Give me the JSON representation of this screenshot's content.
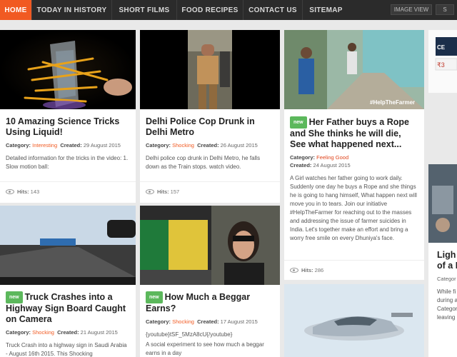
{
  "nav": {
    "items": [
      "HOME",
      "TODAY IN HISTORY",
      "SHORT FILMS",
      "FOOD RECIPES",
      "CONTACT US",
      "SITEMAP"
    ],
    "image_view": "IMAGE VIEW",
    "s_button": "S"
  },
  "labels": {
    "category": "Category:",
    "created": "Created:",
    "hits": "Hits:",
    "new": "new"
  },
  "cards": [
    {
      "title": "10 Amazing Science Tricks Using Liquid!",
      "category": "Interesting",
      "created": "29 August 2015",
      "desc": "Detailed information for the tricks in the video: 1. Slow motion ball:",
      "hits": "143"
    },
    {
      "title": "Delhi Police Cop Drunk in Delhi Metro",
      "category": "Shocking",
      "created": "26 August 2015",
      "desc": "Delhi police cop drunk in Delhi Metro, he falls down as the Train stops. watch video.",
      "hits": "157"
    },
    {
      "title": "Her Father buys a Rope and She thinks he will die, See what happened next...",
      "category": "Feeling Good",
      "created": "24 August 2015",
      "desc": "A Girl watches her father going to work daily. Suddenly one day he buys a Rope and she things he is going to hang himself, What happen next will move you in to tears. Join our initiative #HelpTheFarmer for reaching out to the masses and addressing the issue of farmer suicides in India. Let's together make an effort and bring a worry free smile on every Dhuniya's face.",
      "hits": "286",
      "image_caption": "#HelpTheFarmer"
    },
    {
      "title": "Truck Crashes into a Highway Sign Board Caught on Camera",
      "category": "Shocking",
      "created": "21 August 2015",
      "desc": "Truck Crash into a highway sign in Saudi Arabia - August 16th 2015. This Shocking"
    },
    {
      "title": "How Much a Beggar Earns?",
      "category": "Shocking",
      "created": "17 August 2015",
      "desc1": "{youtube}tSF_5MzA8cU{/youtube}",
      "desc2": "A social experiment to see how much a beggar earns in a day"
    }
  ],
  "partial": {
    "title": "Ligh",
    "title2": "of a F",
    "category": "Categor",
    "desc": [
      "While fi",
      "during a",
      "Categor",
      "leaving c"
    ],
    "ad_text": "CE",
    "ad_price": "₹3"
  }
}
